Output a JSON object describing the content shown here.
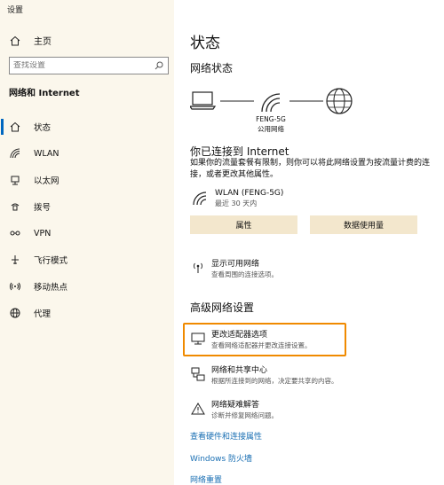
{
  "window": {
    "title": "设置"
  },
  "sidebar": {
    "home_label": "主页",
    "search_placeholder": "查找设置",
    "section_title": "网络和 Internet",
    "items": [
      {
        "label": "状态",
        "icon": "home-status-icon",
        "active": true
      },
      {
        "label": "WLAN",
        "icon": "wifi-icon"
      },
      {
        "label": "以太网",
        "icon": "ethernet-icon"
      },
      {
        "label": "拨号",
        "icon": "dialup-icon"
      },
      {
        "label": "VPN",
        "icon": "vpn-icon"
      },
      {
        "label": "飞行模式",
        "icon": "airplane-icon"
      },
      {
        "label": "移动热点",
        "icon": "hotspot-icon"
      },
      {
        "label": "代理",
        "icon": "globe-icon"
      }
    ]
  },
  "main": {
    "title": "状态",
    "network_status_heading": "网络状态",
    "network_name": "FENG-5G",
    "network_type": "公用网络",
    "connected_heading": "你已连接到 Internet",
    "connected_desc": "如果你的流量套餐有限制，则你可以将此网络设置为按流量计费的连接，或者更改其他属性。",
    "connection": {
      "name": "WLAN (FENG-5G)",
      "sub": "最近 30 天内"
    },
    "buttons": {
      "properties": "属性",
      "data_usage": "数据使用量"
    },
    "show_networks": {
      "name": "显示可用网络",
      "sub": "查看周围的连接选项。"
    },
    "advanced_heading": "高级网络设置",
    "adapter": {
      "name": "更改适配器选项",
      "sub": "查看网络适配器并更改连接设置。"
    },
    "sharing": {
      "name": "网络和共享中心",
      "sub": "根据所连接到的网络，决定要共享的内容。"
    },
    "troubleshoot": {
      "name": "网络疑难解答",
      "sub": "诊断并修复网络问题。"
    },
    "links": {
      "hardware": "查看硬件和连接属性",
      "firewall": "Windows 防火墙",
      "reset": "网络重置"
    },
    "colors": {
      "accent": "#0067c0",
      "link": "#1a6fb3",
      "highlight": "#f08a00",
      "button_bg": "#f3e7cd"
    }
  }
}
